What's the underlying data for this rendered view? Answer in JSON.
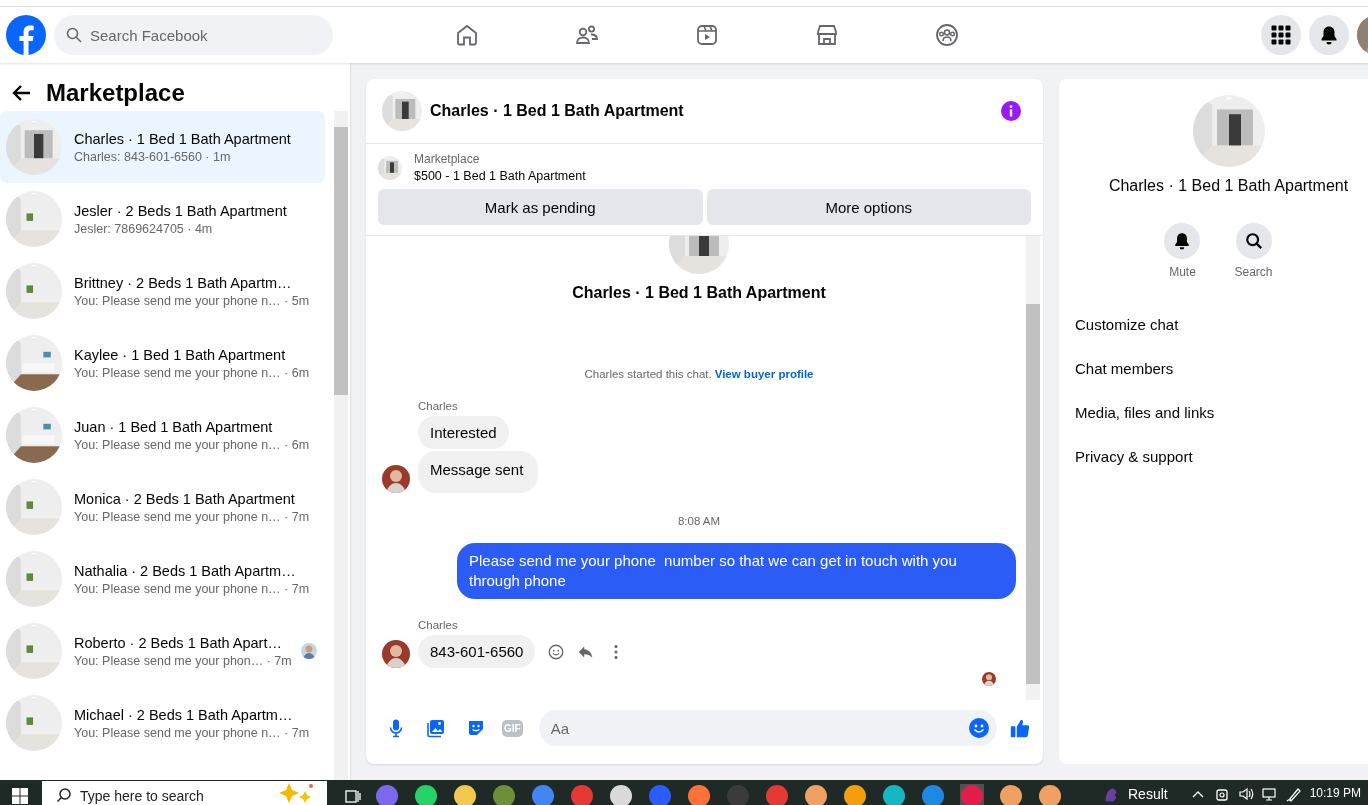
{
  "top_bar": {
    "search": {
      "placeholder": "Search Facebook"
    }
  },
  "sidebar": {
    "title": "Marketplace",
    "chats": [
      {
        "title": "Charles · 1 Bed 1 Bath Apartment",
        "preview": "Charles: 843-601-6560 · 1m",
        "selected": true,
        "seen": false
      },
      {
        "title": "Jesler · 2 Beds 1 Bath Apartment",
        "preview": "Jesler: 7869624705 · 4m",
        "selected": false,
        "seen": false
      },
      {
        "title": "Brittney · 2 Beds 1 Bath Apartm…",
        "preview": "You: Please send me your phone n… · 5m",
        "selected": false,
        "seen": false
      },
      {
        "title": "Kaylee · 1 Bed 1 Bath Apartment",
        "preview": "You: Please send me your phone n… · 6m",
        "selected": false,
        "seen": false
      },
      {
        "title": "Juan · 1 Bed 1 Bath Apartment",
        "preview": "You: Please send me your phone n… · 6m",
        "selected": false,
        "seen": false
      },
      {
        "title": "Monica · 2 Beds 1 Bath Apartment",
        "preview": "You: Please send me your phone n… · 7m",
        "selected": false,
        "seen": false
      },
      {
        "title": "Nathalia · 2 Beds 1 Bath Apartm…",
        "preview": "You: Please send me your phone n… · 7m",
        "selected": false,
        "seen": false
      },
      {
        "title": "Roberto · 2 Beds 1 Bath Apart…",
        "preview": "You: Please send me your phon… · 7m",
        "selected": false,
        "seen": true
      },
      {
        "title": "Michael · 2 Beds 1 Bath Apartm…",
        "preview": "You: Please send me your phone n… · 7m",
        "selected": false,
        "seen": false
      }
    ]
  },
  "conversation": {
    "title": "Charles · 1 Bed 1 Bath Apartment",
    "listing": {
      "label": "Marketplace",
      "price_title": "$500 - 1 Bed 1 Bath Apartment"
    },
    "buttons": [
      "Mark as pending",
      "More options"
    ],
    "thread_title": "Charles · 1 Bed 1 Bath Apartment",
    "started": {
      "text": "Charles started this chat.",
      "link": "View buyer profile"
    },
    "messages": [
      {
        "kind": "sender",
        "text": "Charles"
      },
      {
        "kind": "incoming",
        "bubbles": [
          "Interested",
          "Message sent"
        ],
        "actions": false
      },
      {
        "kind": "time",
        "text": "8:08 AM"
      },
      {
        "kind": "outgoing",
        "bubbles": [
          "Please send me your phone  number so that we can get in touch with you through phone"
        ]
      },
      {
        "kind": "sender",
        "text": "Charles"
      },
      {
        "kind": "incoming",
        "bubbles": [
          "843-601-6560"
        ],
        "actions": true
      },
      {
        "kind": "seen"
      }
    ],
    "composer": {
      "placeholder": "Aa",
      "gif_label": "GIF"
    }
  },
  "details": {
    "title": "Charles · 1 Bed 1 Bath Apartment",
    "actions": [
      "Mute",
      "Search"
    ],
    "menu": [
      "Customize chat",
      "Chat members",
      "Media, files and links",
      "Privacy & support"
    ]
  },
  "taskbar": {
    "search": {
      "placeholder": "Type here to search"
    },
    "widget": "Result",
    "time": "10:19 PM"
  }
}
